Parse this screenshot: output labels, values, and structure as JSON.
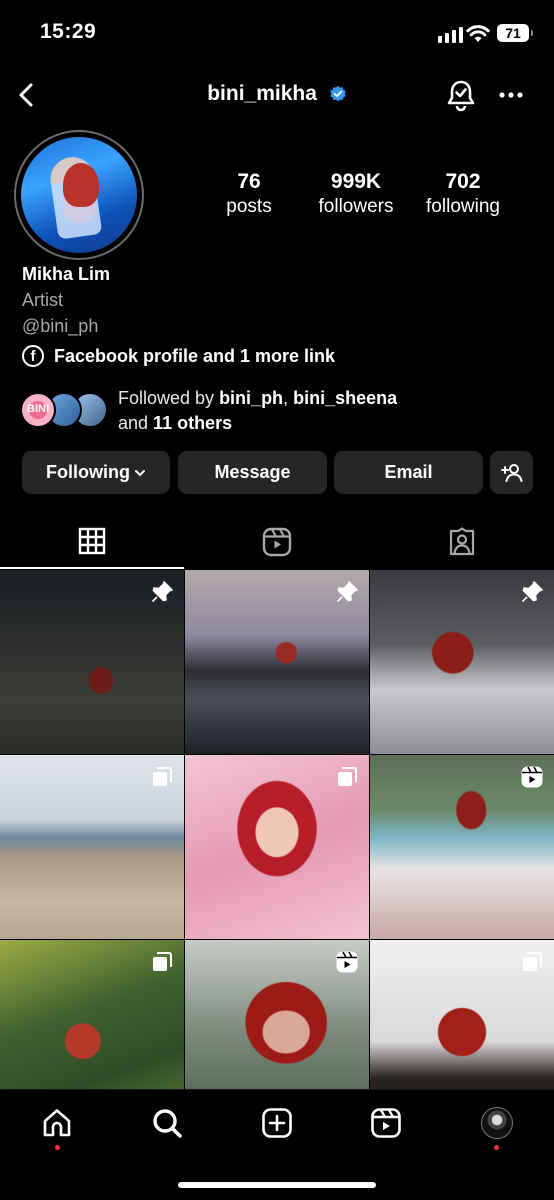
{
  "status_bar": {
    "time": "15:29",
    "battery": "71"
  },
  "header": {
    "username": "bini_mikha",
    "verified": true
  },
  "profile": {
    "posts_count": "76",
    "posts_label": "posts",
    "followers_count": "999K",
    "followers_label": "followers",
    "following_count": "702",
    "following_label": "following",
    "name": "Mikha Lim",
    "category": "Artist",
    "handle": "@bini_ph",
    "links_text": "Facebook profile and 1 more link"
  },
  "followed_by": {
    "prefix": "Followed by ",
    "user1": "bini_ph",
    "separator": ", ",
    "user2": "bini_sheena",
    "connector": "and ",
    "others": "11 others",
    "avatar1_label": "BINI"
  },
  "actions": {
    "following_label": "Following",
    "message_label": "Message",
    "email_label": "Email"
  },
  "tabs": [
    "grid-icon",
    "reels-icon",
    "tagged-icon"
  ],
  "grid": [
    {
      "badge": "pin-icon"
    },
    {
      "badge": "pin-icon"
    },
    {
      "badge": "pin-icon"
    },
    {
      "badge": "carousel-icon"
    },
    {
      "badge": "carousel-icon"
    },
    {
      "badge": "reel-icon"
    },
    {
      "badge": "carousel-icon"
    },
    {
      "badge": "reel-icon"
    },
    {
      "badge": "carousel-icon"
    }
  ],
  "bottom_nav": [
    "home-icon",
    "search-icon",
    "create-icon",
    "reels-icon",
    "profile-avatar"
  ],
  "colors": {
    "background": "#000000",
    "button": "#262626",
    "verified": "#3897f0",
    "notification_dot": "#ff3040"
  }
}
